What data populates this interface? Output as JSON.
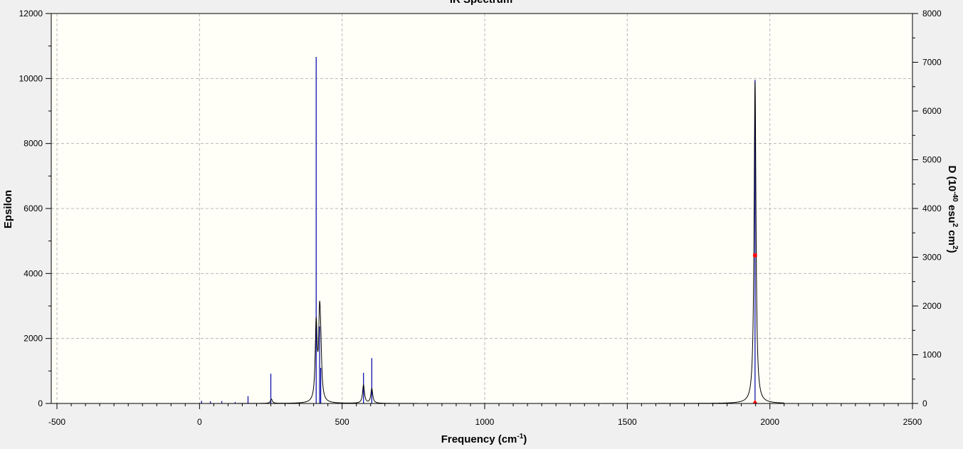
{
  "chart_data": {
    "type": "line",
    "title": "IR Spectrum",
    "xlabel": {
      "text": "Frequency (cm",
      "sup": "-1",
      "close": ")"
    },
    "ylabel_left": "Epsilon",
    "ylabel_right": {
      "main": "D (10",
      "sup1": "-40",
      "mid": " esu",
      "sup2": "2",
      "mid2": " cm",
      "sup3": "2",
      "close": ")"
    },
    "xlim": [
      -520,
      2500
    ],
    "ylim_left": [
      0,
      12000
    ],
    "ylim_right": [
      0,
      8000
    ],
    "x_ticks": [
      -500,
      0,
      500,
      1000,
      1500,
      2000,
      2500
    ],
    "y_ticks_left": [
      0,
      2000,
      4000,
      6000,
      8000,
      10000,
      12000
    ],
    "y_ticks_right": [
      0,
      1000,
      2000,
      3000,
      4000,
      5000,
      6000,
      7000,
      8000
    ],
    "grid": true,
    "colors": {
      "plot_background": "#fffff8",
      "outer_background": "#f0f0f0",
      "spectrum_line": "#000000",
      "stick_line": "#0000aa",
      "marker": "#ff0000",
      "grid": "#b8b8b8"
    },
    "series": [
      {
        "type": "broadened-spectrum",
        "peaks": [
          {
            "x": 252,
            "eps": 130
          },
          {
            "x": 409,
            "eps": 2350
          },
          {
            "x": 421,
            "eps": 2350
          },
          {
            "x": 425,
            "eps": 1100
          },
          {
            "x": 575,
            "eps": 560
          },
          {
            "x": 604,
            "eps": 450
          },
          {
            "x": 1948,
            "eps": 9900
          }
        ],
        "x_range": [
          -20,
          2050
        ]
      },
      {
        "type": "sticks",
        "sticks": [
          {
            "x": 7,
            "d": 55
          },
          {
            "x": 38,
            "d": 45
          },
          {
            "x": 78,
            "d": 50
          },
          {
            "x": 125,
            "d": 30
          },
          {
            "x": 170,
            "d": 150
          },
          {
            "x": 250,
            "d": 610
          },
          {
            "x": 409,
            "d": 7110
          },
          {
            "x": 421,
            "d": 1580
          },
          {
            "x": 425,
            "d": 730
          },
          {
            "x": 575,
            "d": 630
          },
          {
            "x": 604,
            "d": 930
          },
          {
            "x": 1948,
            "d": 6640
          }
        ]
      }
    ],
    "markers": [
      {
        "x": 1948,
        "eps": 4560,
        "shape": "star"
      },
      {
        "x": 1948,
        "eps": 0,
        "shape": "triangle"
      }
    ]
  }
}
